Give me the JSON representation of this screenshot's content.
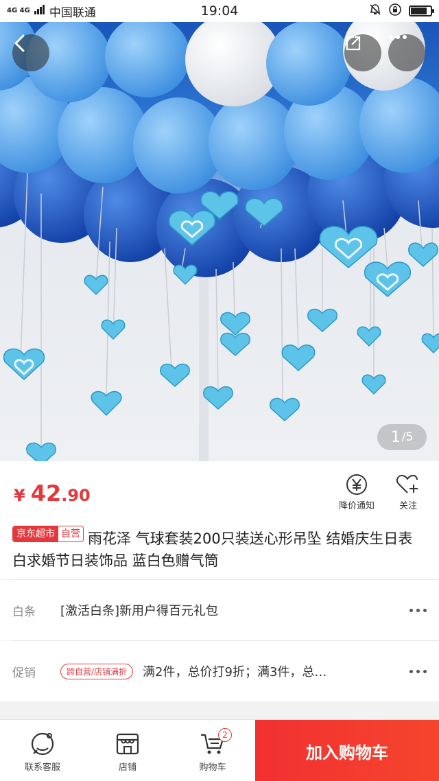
{
  "status_bar": {
    "network": "4G 4G",
    "carrier": "中国联通",
    "time": "19:04"
  },
  "gallery": {
    "current": "1",
    "total": "/5"
  },
  "price": {
    "currency": "¥",
    "integer": "42",
    "decimal": ".90"
  },
  "actions": {
    "price_alert": "降价通知",
    "follow": "关注"
  },
  "product": {
    "badge_store": "京东超市",
    "badge_self": "自营",
    "title": "雨花泽 气球套装200只装送心形吊坠 结婚庆生日表白求婚节日装饰品 蓝白色赠气筒"
  },
  "baitiao": {
    "label": "白条",
    "text": "[激活白条]新用户得百元礼包"
  },
  "promo": {
    "label": "促销",
    "tag": "跨自营/店铺满折",
    "text": "满2件，总价打9折；满3件，总…"
  },
  "bottom": {
    "service": "联系客服",
    "shop": "店铺",
    "cart": "购物车",
    "cart_count": "2",
    "add_cart": "加入购物车"
  },
  "colors": {
    "accent": "#e4393c",
    "cart_button": "#f23030"
  }
}
